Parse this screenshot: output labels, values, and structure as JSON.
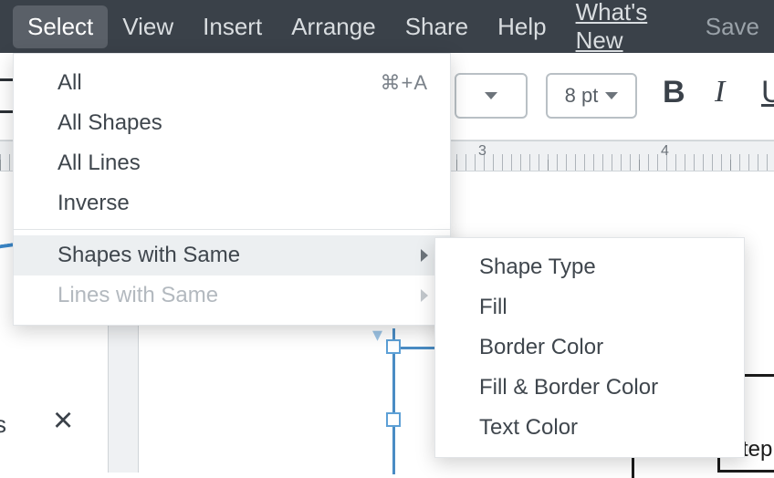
{
  "menubar": {
    "select": "Select",
    "view": "View",
    "insert": "Insert",
    "arrange": "Arrange",
    "share": "Share",
    "help": "Help",
    "whatsnew": "What's New",
    "save": "Save"
  },
  "toolbar": {
    "font_size": "8 pt",
    "bold": "B",
    "italic": "I",
    "underline": "U"
  },
  "ruler": {
    "mark3": "3",
    "mark4": "4"
  },
  "select_menu": {
    "all": "All",
    "all_shortcut": "⌘+A",
    "all_shapes": "All Shapes",
    "all_lines": "All Lines",
    "inverse": "Inverse",
    "shapes_with_same": "Shapes with Same",
    "lines_with_same": "Lines with Same"
  },
  "shapes_submenu": {
    "shape_type": "Shape Type",
    "fill": "Fill",
    "border_color": "Border Color",
    "fill_border_color": "Fill & Border Color",
    "text_color": "Text Color"
  },
  "canvas": {
    "step_label": "Step",
    "side_letter": "s",
    "close": "×"
  }
}
